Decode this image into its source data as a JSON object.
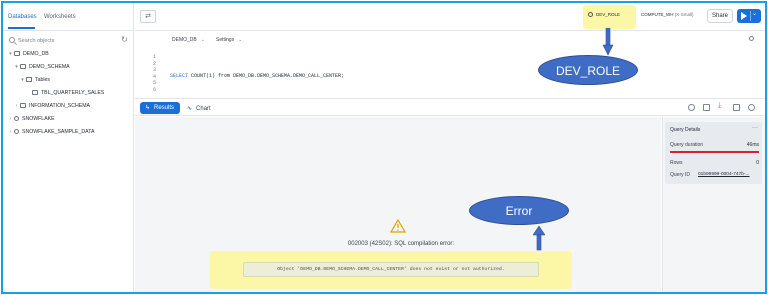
{
  "sidebar": {
    "tabs": [
      "Databases",
      "Worksheets"
    ],
    "search_placeholder": "Search objects",
    "tree": [
      {
        "label": "DEMO_DB",
        "chev": "▾",
        "icon": "database-icon",
        "indent": 0
      },
      {
        "label": "DEMO_SCHEMA",
        "chev": "▾",
        "icon": "schema-icon",
        "indent": 1
      },
      {
        "label": "Tables",
        "chev": "▾",
        "icon": "folder-icon",
        "indent": 2
      },
      {
        "label": "TBL_QUARTERLY_SALES",
        "chev": "",
        "icon": "table-icon",
        "indent": 3
      },
      {
        "label": "INFORMATION_SCHEMA",
        "chev": "›",
        "icon": "schema-icon",
        "indent": 1
      },
      {
        "label": "SNOWFLAKE",
        "chev": "›",
        "icon": "share-icon",
        "indent": 0
      },
      {
        "label": "SNOWFLAKE_SAMPLE_DATA",
        "chev": "›",
        "icon": "share-icon",
        "indent": 0
      }
    ]
  },
  "topbar": {
    "role": "DEV_ROLE",
    "warehouse": "COMPUTE_WH",
    "warehouse_size": "(X-Small)",
    "share_label": "Share"
  },
  "editor_bar": {
    "database": "DEMO_DB",
    "settings": "Settings"
  },
  "editor": {
    "line_numbers": [
      "1",
      "2",
      "3",
      "4",
      "5",
      "6"
    ],
    "code_keyword": "SELECT",
    "code_rest": " COUNT(1) from DEMO_DB.DEMO_SCHEMA.DEMO_CALL_CENTER;"
  },
  "results_bar": {
    "results_label": "Results",
    "chart_label": "Chart"
  },
  "error": {
    "code": "002003 (42S02): SQL compilation error:",
    "message": "Object 'DEMO_DB.DEMO_SCHEMA.DEMO_CALL_CENTER' does not exist or not authorized."
  },
  "query_details": {
    "title": "Query Details",
    "menu": "···",
    "duration_label": "Query duration",
    "duration_value": "46ms",
    "rows_label": "Rows",
    "rows_value": "0",
    "id_label": "Query ID",
    "id_value": "01b99999-0004-747b-..."
  },
  "annotations": {
    "role_callout": "DEV_ROLE",
    "error_callout": "Error"
  },
  "colors": {
    "accent": "#1a6fd8",
    "highlight": "#fbf7a6",
    "callout": "#3f6cc5",
    "error_bar": "#d8232a",
    "frame": "#17a0e8"
  }
}
